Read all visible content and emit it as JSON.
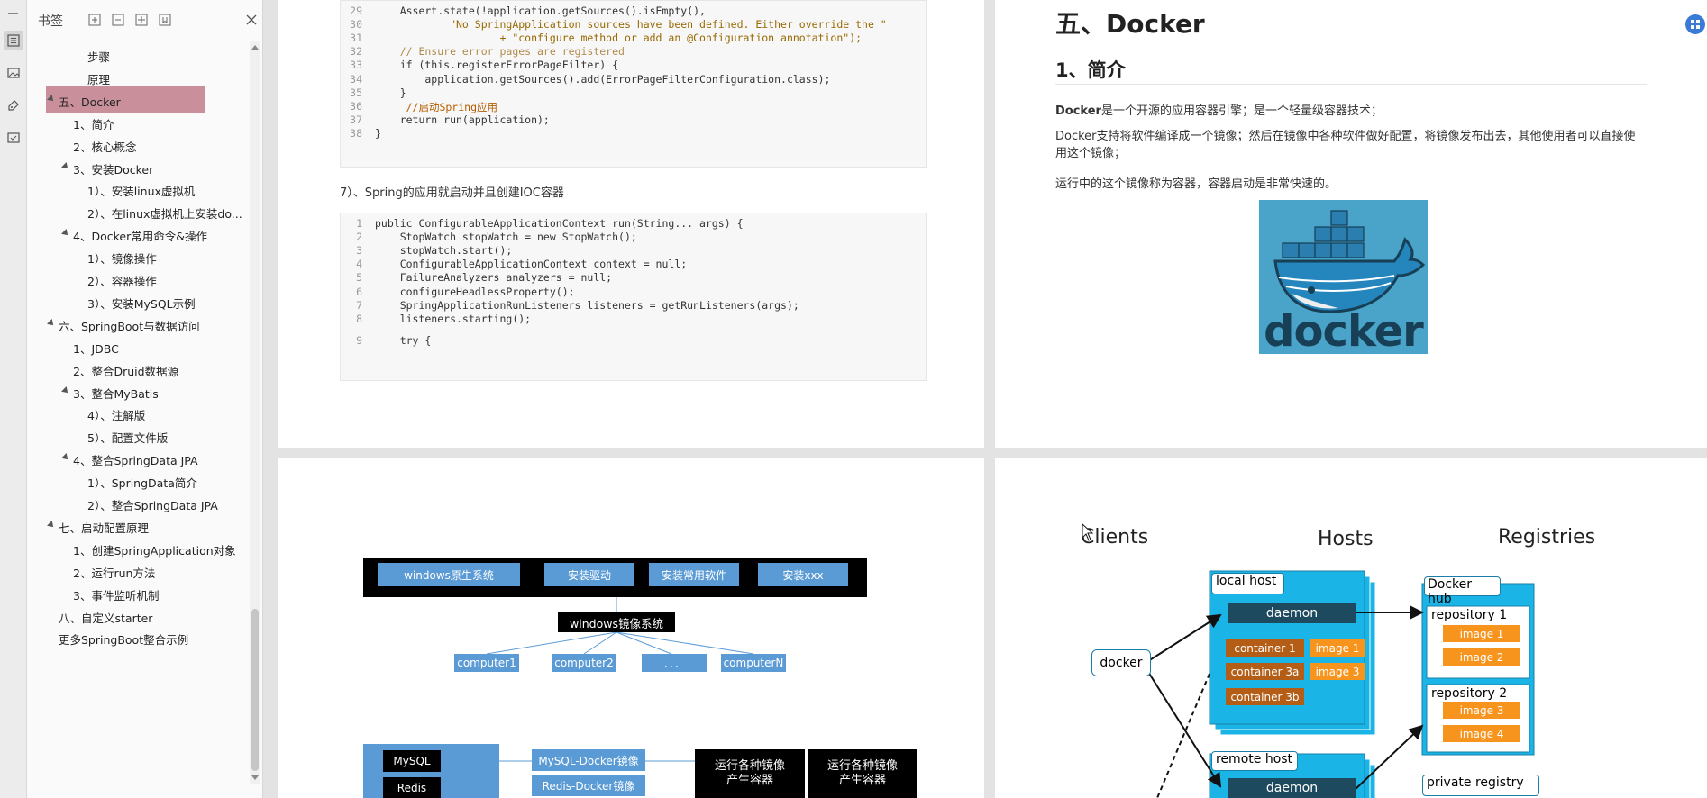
{
  "sidebar": {
    "title": "书签",
    "items": [
      {
        "label": "步骤",
        "level": 3,
        "expanded": null
      },
      {
        "label": "原理",
        "level": 3,
        "expanded": null
      },
      {
        "label": "五、Docker",
        "level": 1,
        "expanded": true,
        "selected": true
      },
      {
        "label": "1、简介",
        "level": 2,
        "expanded": null
      },
      {
        "label": "2、核心概念",
        "level": 2,
        "expanded": null
      },
      {
        "label": "3、安装Docker",
        "level": 2,
        "expanded": true
      },
      {
        "label": "1）、安装linux虚拟机",
        "level": 3,
        "expanded": null
      },
      {
        "label": "2）、在linux虚拟机上安装do...",
        "level": 3,
        "expanded": null
      },
      {
        "label": "4、Docker常用命令&操作",
        "level": 2,
        "expanded": true
      },
      {
        "label": "1）、镜像操作",
        "level": 3,
        "expanded": null
      },
      {
        "label": "2）、容器操作",
        "level": 3,
        "expanded": null
      },
      {
        "label": "3）、安装MySQL示例",
        "level": 3,
        "expanded": null
      },
      {
        "label": "六、SpringBoot与数据访问",
        "level": 1,
        "expanded": true
      },
      {
        "label": "1、JDBC",
        "level": 2,
        "expanded": null
      },
      {
        "label": "2、整合Druid数据源",
        "level": 2,
        "expanded": null
      },
      {
        "label": "3、整合MyBatis",
        "level": 2,
        "expanded": true
      },
      {
        "label": "4）、注解版",
        "level": 3,
        "expanded": null
      },
      {
        "label": "5）、配置文件版",
        "level": 3,
        "expanded": null
      },
      {
        "label": "4、整合SpringData JPA",
        "level": 2,
        "expanded": true
      },
      {
        "label": "1）、SpringData简介",
        "level": 3,
        "expanded": null
      },
      {
        "label": "2）、整合SpringData JPA",
        "level": 3,
        "expanded": null
      },
      {
        "label": "七、启动配置原理",
        "level": 1,
        "expanded": true
      },
      {
        "label": "1、创建SpringApplication对象",
        "level": 2,
        "expanded": null
      },
      {
        "label": "2、运行run方法",
        "level": 2,
        "expanded": null
      },
      {
        "label": "3、事件监听机制",
        "level": 2,
        "expanded": null
      },
      {
        "label": "八、自定义starter",
        "level": 1,
        "expanded": null
      },
      {
        "label": "更多SpringBoot整合示例",
        "level": 1,
        "expanded": null
      }
    ]
  },
  "page1": {
    "code1": [
      {
        "n": "29",
        "t": "    Assert.state(!application.getSources().isEmpty(),"
      },
      {
        "n": "30",
        "t": "            \"No SpringApplication sources have been defined. Either override the \""
      },
      {
        "n": "31",
        "t": "                    + \"configure method or add an @Configuration annotation\");"
      },
      {
        "n": "32",
        "t": "    // Ensure error pages are registered"
      },
      {
        "n": "33",
        "t": "    if (this.registerErrorPageFilter) {"
      },
      {
        "n": "34",
        "t": "        application.getSources().add(ErrorPageFilterConfiguration.class);"
      },
      {
        "n": "35",
        "t": "    }"
      },
      {
        "n": "36",
        "t": "     //启动Spring应用"
      },
      {
        "n": "37",
        "t": "    return run(application);"
      },
      {
        "n": "38",
        "t": "}"
      }
    ],
    "step_text": "7）、Spring的应用就启动并且创建IOC容器",
    "code2": [
      {
        "n": "1",
        "t": "public ConfigurableApplicationContext run(String... args) {"
      },
      {
        "n": "2",
        "t": "    StopWatch stopWatch = new StopWatch();"
      },
      {
        "n": "3",
        "t": "    stopWatch.start();"
      },
      {
        "n": "4",
        "t": "    ConfigurableApplicationContext context = null;"
      },
      {
        "n": "5",
        "t": "    FailureAnalyzers analyzers = null;"
      },
      {
        "n": "6",
        "t": "    configureHeadlessProperty();"
      },
      {
        "n": "7",
        "t": "    SpringApplicationRunListeners listeners = getRunListeners(args);"
      },
      {
        "n": "8",
        "t": "    listeners.starting();"
      },
      {
        "n": "9",
        "t": "    try {"
      }
    ]
  },
  "page2": {
    "h1": "五、Docker",
    "h2": "1、简介",
    "p1_bold": "Docker",
    "p1_rest": "是一个开源的应用容器引擎；是一个轻量级容器技术；",
    "p2": "Docker支持将软件编译成一个镜像；然后在镜像中各种软件做好配置，将镜像发布出去，其他使用者可以直接使用这个镜像；",
    "p3": "运行中的这个镜像称为容器，容器启动是非常快速的。",
    "logo_text": "docker"
  },
  "page3": {
    "row1": [
      "windows原生系统",
      "安装驱动",
      "安装常用软件",
      "安装xxx"
    ],
    "mirror": "windows镜像系统",
    "computers": [
      "computer1",
      "computer2",
      "．．．",
      "computerN"
    ],
    "db": [
      "MySQL",
      "Redis"
    ],
    "dbimgs": [
      "MySQL-Docker镜像",
      "Redis-Docker镜像"
    ],
    "run": [
      "运行各种镜像\n产生容器",
      "运行各种镜像\n产生容器"
    ]
  },
  "page4": {
    "clients": "Clients",
    "hosts": "Hosts",
    "registries": "Registries",
    "local_host": "local host",
    "daemon": "daemon",
    "docker": "docker",
    "containers": [
      "container 1",
      "container 3a",
      "container 3b"
    ],
    "images_host": [
      "image 1",
      "image 3"
    ],
    "docker_hub": "Docker hub",
    "repo1": "repository 1",
    "repo1_images": [
      "image 1",
      "image 2"
    ],
    "repo2": "repository 2",
    "repo2_images": [
      "image 3",
      "image 4"
    ],
    "remote_host": "remote host",
    "private_registry": "private registry"
  },
  "colors": {
    "selected": "#c9909c",
    "accent": "#1ab4e6",
    "orange": "#f7941e",
    "brown": "#b35d16",
    "dark": "#1e4a5f"
  }
}
